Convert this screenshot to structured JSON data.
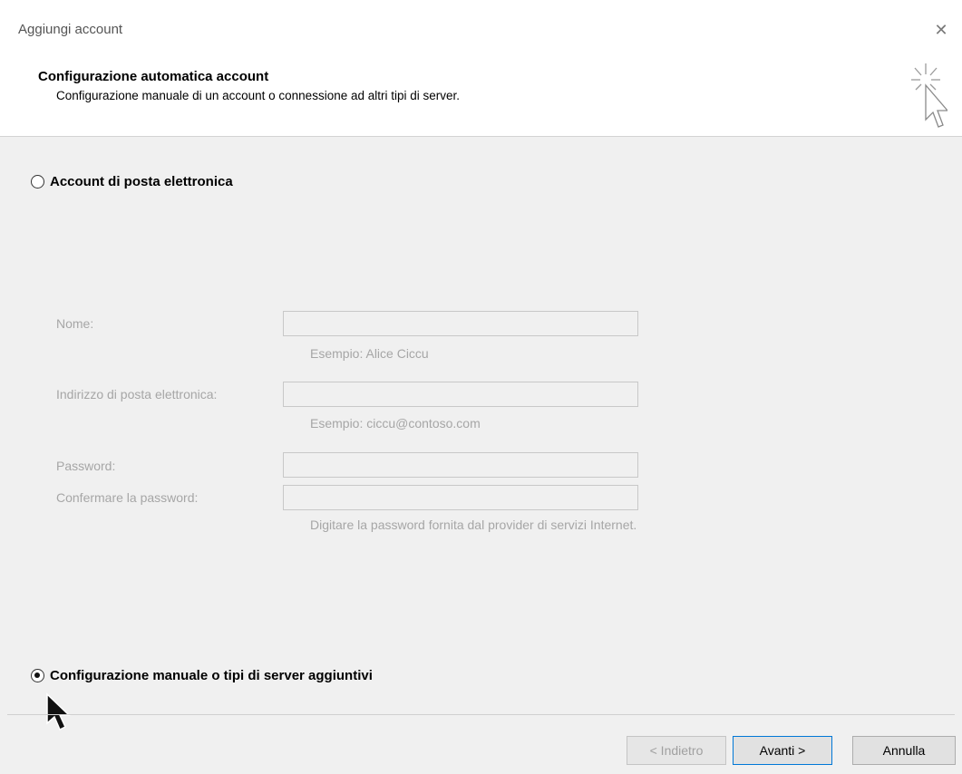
{
  "window": {
    "title": "Aggiungi account",
    "close_glyph": "✕"
  },
  "header": {
    "title": "Configurazione automatica account",
    "subtitle": "Configurazione manuale di un account o connessione ad altri tipi di server.",
    "icon": "wizard-cursor-icon"
  },
  "options": {
    "email_account": {
      "label": "Account di posta elettronica",
      "selected": false
    },
    "manual_config": {
      "label": "Configurazione manuale o tipi di server aggiuntivi",
      "selected": true
    }
  },
  "form": {
    "name_label": "Nome:",
    "name_value": "",
    "name_hint": "Esempio: Alice Ciccu",
    "email_label": "Indirizzo di posta elettronica:",
    "email_value": "",
    "email_hint": "Esempio: ciccu@contoso.com",
    "password_label": "Password:",
    "password_value": "",
    "confirm_label": "Confermare la password:",
    "confirm_value": "",
    "password_hint": "Digitare la password fornita dal provider di servizi Internet."
  },
  "buttons": {
    "back": "< Indietro",
    "next": "Avanti >",
    "cancel": "Annulla"
  },
  "colors": {
    "disabled_text": "#a6a6a6",
    "accent": "#0078d7"
  }
}
